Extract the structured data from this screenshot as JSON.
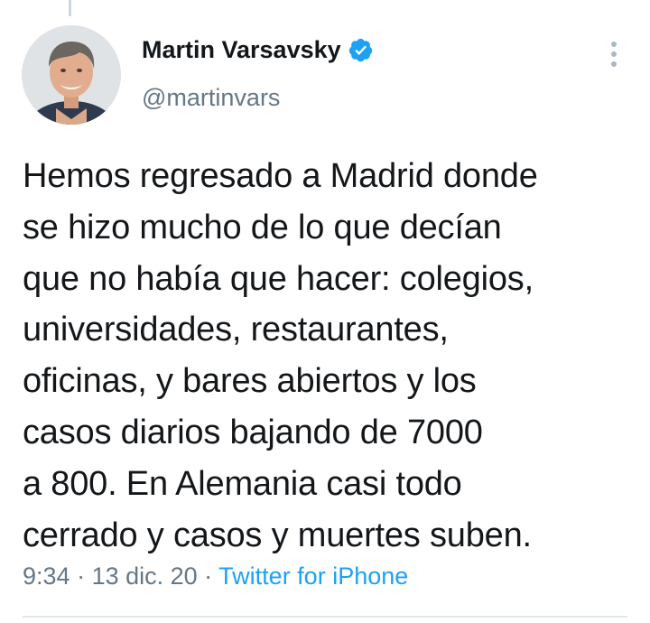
{
  "tweet": {
    "author": {
      "display_name": "Martin Varsavsky",
      "handle": "@martinvars",
      "verified": true,
      "avatar_icon": "user-avatar"
    },
    "text": "Hemos regresado a Madrid donde\nse hizo mucho de lo que decían\nque no había que hacer: colegios,\nuniversidades, restaurantes,\noficinas, y bares abiertos y los\ncasos diarios bajando de 7000\na 800. En Alemania casi todo\ncerrado y casos y muertes suben.",
    "meta": {
      "time": "9:34",
      "separator": " · ",
      "date": "13 dic. 20",
      "source": "Twitter for iPhone"
    },
    "more_icon": "vertical-ellipsis-icon"
  },
  "colors": {
    "text": "#14171a",
    "secondary": "#657786",
    "accent": "#1da1f2",
    "divider": "#e1e8ed"
  }
}
